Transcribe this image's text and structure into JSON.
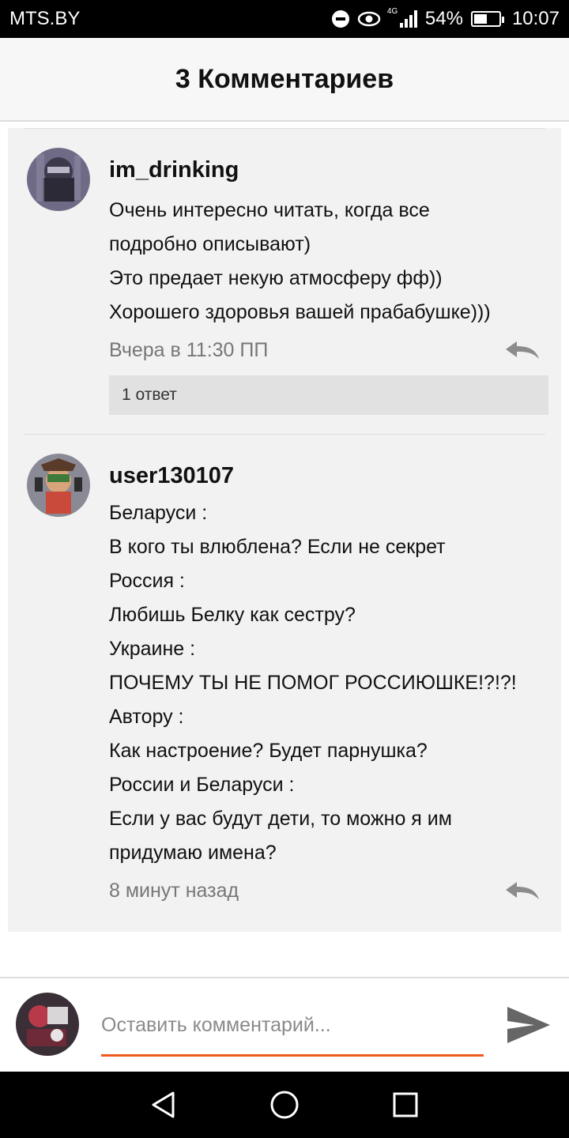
{
  "status_bar": {
    "carrier": "MTS.BY",
    "network": "4G",
    "battery": "54%",
    "battery_level": 0.54,
    "time": "10:07",
    "icons": [
      "do-not-disturb-icon",
      "eye-icon",
      "signal-icon",
      "battery-icon"
    ]
  },
  "header": {
    "title": "3 Комментариев"
  },
  "comments": [
    {
      "username": "im_drinking",
      "lines": [
        "Очень интересно читать, когда все",
        "подробно описывают)",
        "Это предает некую атмосферу фф))",
        "Хорошего здоровья вашей прабабушке)))"
      ],
      "time": "Вчера в 11:30 ПП",
      "replies_label": "1 ответ"
    },
    {
      "username": "user130107",
      "lines": [
        "Беларуси :",
        "В кого ты влюблена? Если не секрет",
        "Россия :",
        "Любишь Белку как сестру?",
        "Украине :",
        "ПОЧЕМУ ТЫ НЕ ПОМОГ РОССИЮШКЕ!?!?!",
        "Автору :",
        "Как настроение? Будет парнушка?",
        "России и Беларуси :",
        "Если у вас будут дети, то можно я им",
        "придумаю имена?"
      ],
      "time": "8 минут назад"
    }
  ],
  "input": {
    "placeholder": "Оставить комментарий..."
  },
  "colors": {
    "accent": "#f05a1c",
    "status_bar_bg": "#000000",
    "comment_bg": "#f2f2f2",
    "icon_gray": "#8c8c8c"
  },
  "nav": {
    "icons": [
      "back-icon",
      "home-icon",
      "recents-icon"
    ]
  }
}
